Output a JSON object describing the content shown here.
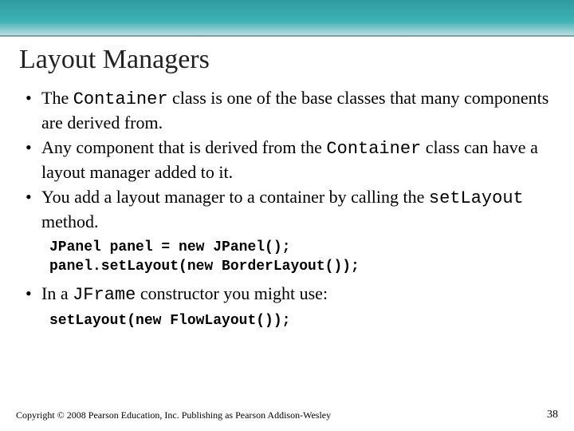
{
  "title": "Layout Managers",
  "bullets": [
    {
      "pre": "The ",
      "code": "Container",
      "post": " class is one of the base classes that many components are derived from."
    },
    {
      "pre": "Any component that is derived from the ",
      "code": "Container",
      "post": " class can have a layout manager added to it."
    },
    {
      "pre": "You add a layout manager to a container by calling the ",
      "code": "setLayout",
      "post": " method."
    }
  ],
  "codeblock1_line1": "JPanel panel = new JPanel();",
  "codeblock1_line2": "panel.setLayout(new BorderLayout());",
  "bullet4": {
    "pre": "In a ",
    "code": "JFrame",
    "post": " constructor you might use:"
  },
  "codeblock2": "setLayout(new FlowLayout());",
  "footer_copyright": "Copyright © 2008 Pearson Education, Inc. Publishing as Pearson Addison-Wesley",
  "page_number": "38"
}
